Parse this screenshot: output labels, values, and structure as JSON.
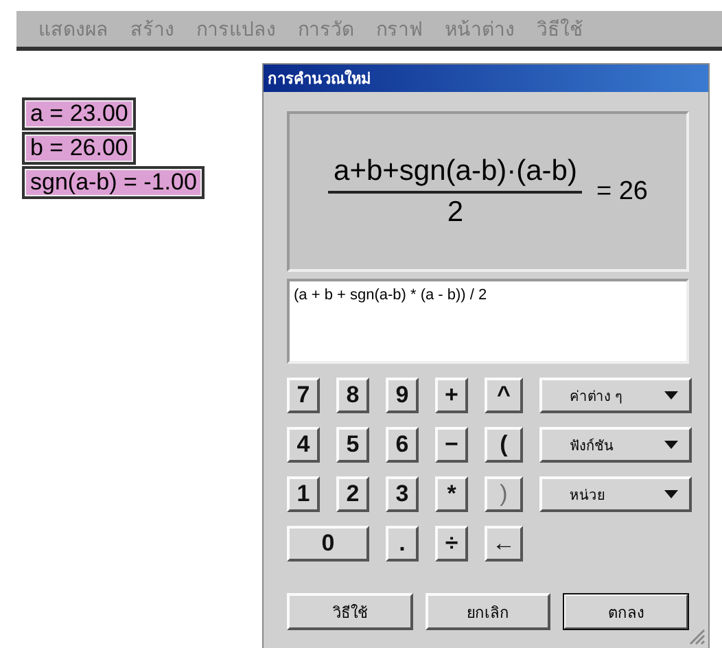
{
  "menu": [
    {
      "label": "แสดงผล",
      "disabled": true
    },
    {
      "label": "สร้าง",
      "disabled": true
    },
    {
      "label": "การแปลง",
      "disabled": true
    },
    {
      "label": "การวัด",
      "disabled": true
    },
    {
      "label": "กราฟ",
      "disabled": true
    },
    {
      "label": "หน้าต่าง",
      "disabled": true
    },
    {
      "label": "วิธีใช้",
      "disabled": true
    }
  ],
  "variables": [
    "a = 23.00",
    "b = 26.00",
    "sgn(a-b) = -1.00"
  ],
  "dialog": {
    "title": "การคำนวณใหม่",
    "preview": {
      "numerator": "a+b+sgn(a-b)·(a-b)",
      "denominator": "2",
      "result": "= 26"
    },
    "expression": {
      "value": "(a + b + sgn(a-b) * (a - b)) / 2"
    },
    "keypad": [
      [
        {
          "label": "7",
          "disabled": false,
          "wide": false
        },
        {
          "label": "8",
          "disabled": false,
          "wide": false
        },
        {
          "label": "9",
          "disabled": false,
          "wide": false
        },
        {
          "label": "+",
          "disabled": false,
          "wide": false
        },
        {
          "label": "^",
          "disabled": false,
          "wide": false
        }
      ],
      [
        {
          "label": "4",
          "disabled": false,
          "wide": false
        },
        {
          "label": "5",
          "disabled": false,
          "wide": false
        },
        {
          "label": "6",
          "disabled": false,
          "wide": false
        },
        {
          "label": "−",
          "disabled": false,
          "wide": false
        },
        {
          "label": "(",
          "disabled": false,
          "wide": false
        }
      ],
      [
        {
          "label": "1",
          "disabled": false,
          "wide": false
        },
        {
          "label": "2",
          "disabled": false,
          "wide": false
        },
        {
          "label": "3",
          "disabled": false,
          "wide": false
        },
        {
          "label": "*",
          "disabled": false,
          "wide": false
        },
        {
          "label": ")",
          "disabled": true,
          "wide": false
        }
      ],
      [
        {
          "label": "0",
          "disabled": false,
          "wide": true
        },
        {
          "label": ".",
          "disabled": false,
          "wide": false
        },
        {
          "label": "÷",
          "disabled": false,
          "wide": false
        },
        {
          "label": "←",
          "disabled": false,
          "wide": false
        }
      ]
    ],
    "dropdowns": [
      "ค่าต่าง ๆ",
      "ฟังก์ชัน",
      "หน่วย"
    ],
    "buttons": [
      {
        "label": "วิธีใช้",
        "default": false
      },
      {
        "label": "ยกเลิก",
        "default": false
      },
      {
        "label": "ตกลง",
        "default": true
      }
    ]
  }
}
